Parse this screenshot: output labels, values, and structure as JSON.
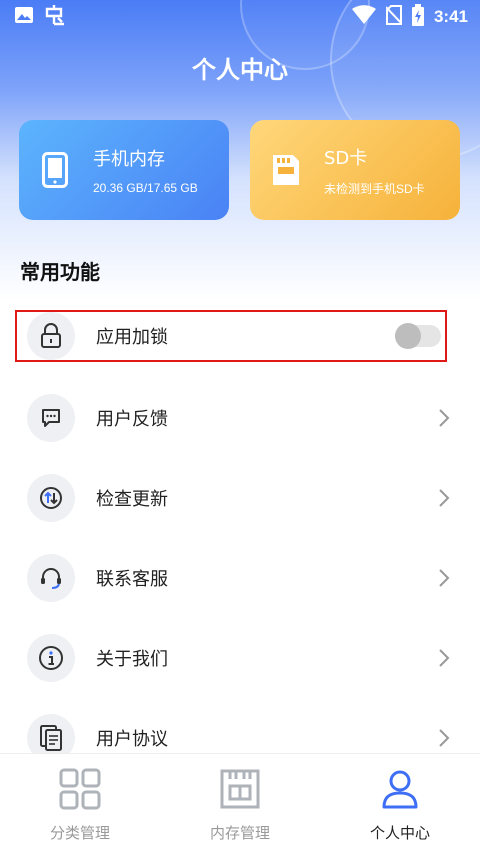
{
  "status_bar": {
    "time": "3:41"
  },
  "page_title": "个人中心",
  "cards": {
    "phone": {
      "title": "手机内存",
      "subtitle": "20.36 GB/17.65 GB"
    },
    "sd": {
      "title": "SD卡",
      "subtitle": "未检测到手机SD卡"
    }
  },
  "section_title": "常用功能",
  "menu": [
    {
      "label": "应用加锁",
      "icon": "lock-icon",
      "control": "toggle",
      "toggle_on": false
    },
    {
      "label": "用户反馈",
      "icon": "feedback-icon",
      "control": "chevron"
    },
    {
      "label": "检查更新",
      "icon": "update-icon",
      "control": "chevron"
    },
    {
      "label": "联系客服",
      "icon": "headset-icon",
      "control": "chevron"
    },
    {
      "label": "关于我们",
      "icon": "info-icon",
      "control": "chevron"
    },
    {
      "label": "用户协议",
      "icon": "document-icon",
      "control": "chevron"
    }
  ],
  "bottom_nav": [
    {
      "label": "分类管理",
      "icon": "grid-icon",
      "active": false
    },
    {
      "label": "内存管理",
      "icon": "memory-icon",
      "active": false
    },
    {
      "label": "个人中心",
      "icon": "person-icon",
      "active": true
    }
  ],
  "colors": {
    "header_blue": "#4a7cf6",
    "phone_card": "#4a82f5",
    "sd_card": "#f6b23a",
    "highlight_border": "#e01818",
    "active_nav": "#3d6ef5"
  }
}
